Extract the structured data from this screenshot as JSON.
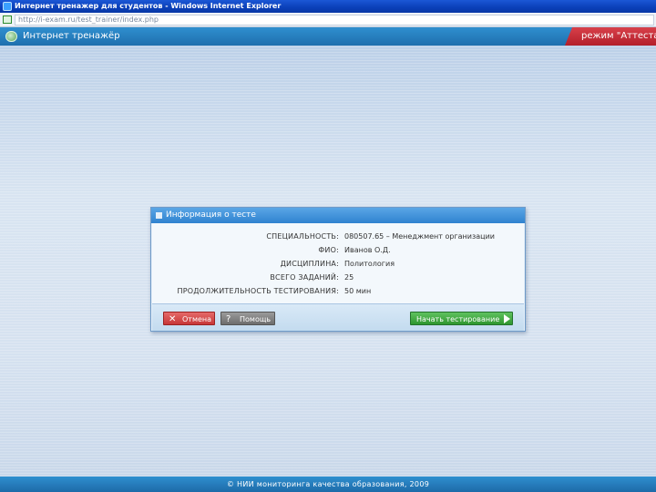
{
  "browser": {
    "title": "Интернет тренажер для студентов - Windows Internet Explorer",
    "url": "http://i-exam.ru/test_trainer/index.php"
  },
  "app": {
    "title": "Интернет тренажёр",
    "mode": "режим \"Аттестация\""
  },
  "dialog": {
    "title": "Информация о тесте",
    "rows": [
      {
        "label": "СПЕЦИАЛЬНОСТЬ:",
        "value": "080507.65 – Менеджмент организации"
      },
      {
        "label": "ФИО:",
        "value": "Иванов О.Д."
      },
      {
        "label": "ДИСЦИПЛИНА:",
        "value": "Политология"
      },
      {
        "label": "ВСЕГО ЗАДАНИЙ:",
        "value": "25"
      },
      {
        "label": "ПРОДОЛЖИТЕЛЬНОСТЬ ТЕСТИРОВАНИЯ:",
        "value": "50 мин"
      }
    ],
    "buttons": {
      "cancel": "Отмена",
      "help": "Помощь",
      "start": "Начать тестирование"
    }
  },
  "footer": {
    "text": "© НИИ мониторинга качества образования, 2009"
  },
  "colors": {
    "header_blue": "#2f8fcf",
    "mode_red": "#c52a35",
    "start_green": "#3fa63f",
    "cancel_red": "#d44848"
  }
}
